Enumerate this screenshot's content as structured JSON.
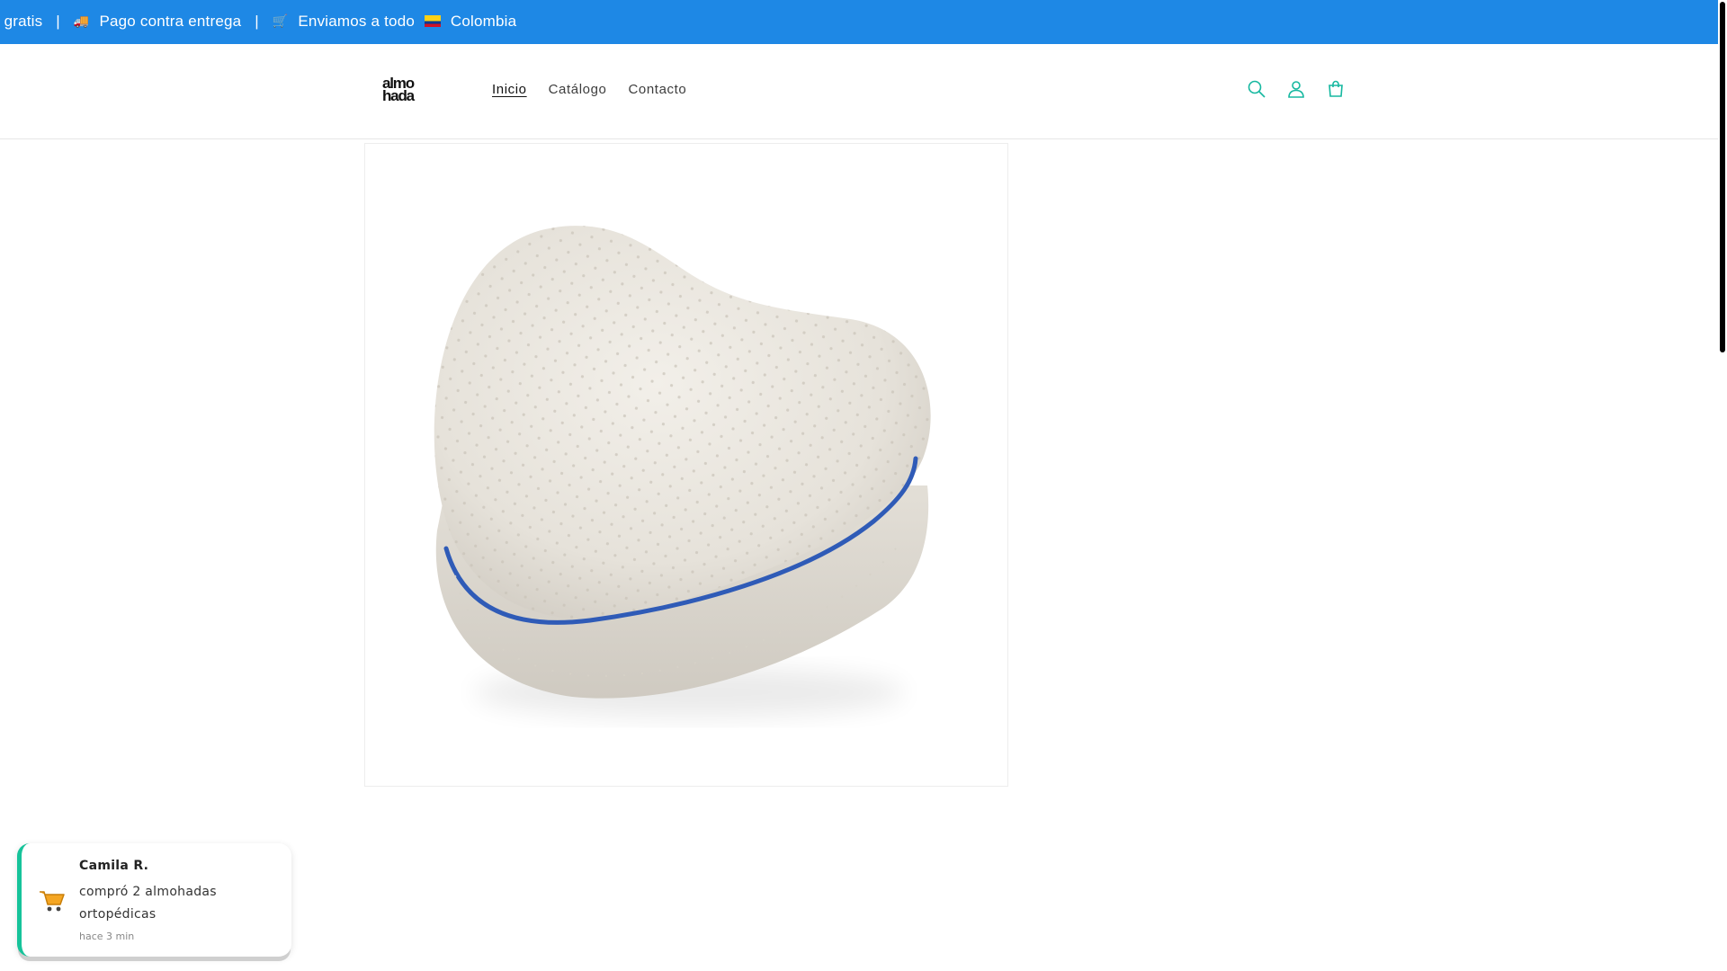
{
  "announcement": {
    "item1": "o gratis",
    "separator": "|",
    "item2_icon": "delivery-truck-icon",
    "item2": "Pago contra entrega",
    "item3_icon": "shopping-cart-icon",
    "item3_a": "Enviamos a todo",
    "item3_flag": "colombia-flag-icon",
    "item3_b": "Colombia",
    "background": "#1e88e5"
  },
  "header": {
    "logo_line1": "almo",
    "logo_line2": "hada",
    "nav": [
      "Inicio",
      "Catálogo",
      "Contacto"
    ],
    "icons": [
      "search-icon",
      "account-icon",
      "cart-icon"
    ],
    "icon_color": "#16b8a0"
  },
  "product": {
    "image_alt": "knee-pillow-image"
  },
  "toast": {
    "name": "Camila R.",
    "message": "compró 2 almohadas ortopédicas",
    "time": "hace 3 min",
    "icon": "shopping-cart-icon",
    "accent": "#16c39a"
  }
}
